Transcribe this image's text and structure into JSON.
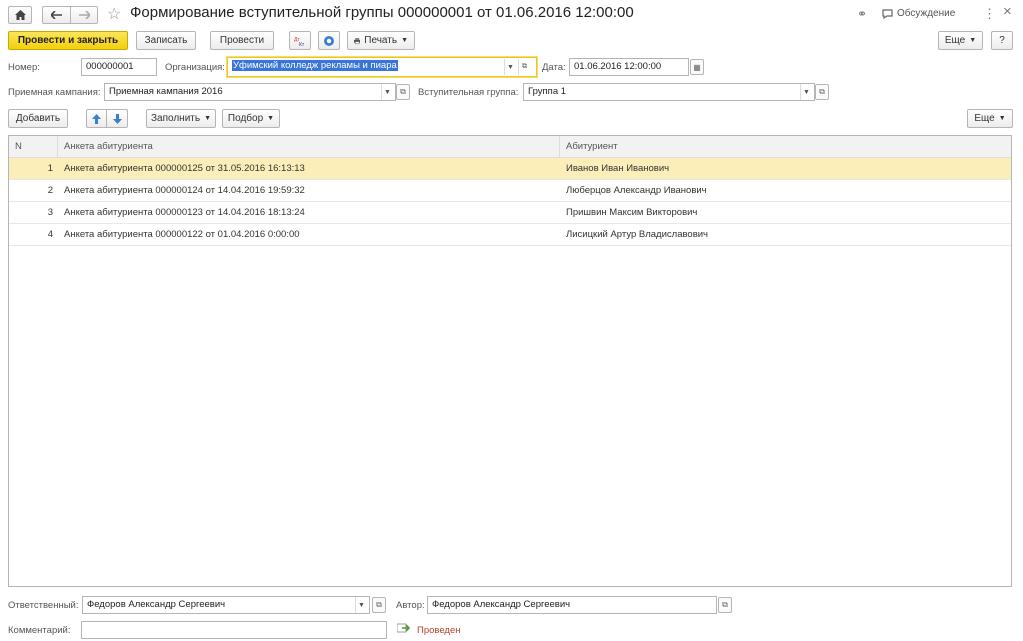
{
  "window": {
    "title": "Формирование вступительной группы 000000001 от 01.06.2016 12:00:00",
    "discussion_label": "Обсуждение",
    "more_icon": "⋮",
    "close_icon": "×"
  },
  "toolbar": {
    "post_close_label": "Провести и закрыть",
    "save_label": "Записать",
    "post_label": "Провести",
    "print_label": "Печать",
    "more_label": "Еще",
    "help_label": "?"
  },
  "form": {
    "number_label": "Номер:",
    "number_value": "000000001",
    "org_label": "Организация:",
    "org_value": "Уфимский колледж рекламы и пиара",
    "date_label": "Дата:",
    "date_value": "01.06.2016 12:00:00",
    "campaign_label": "Приемная кампания:",
    "campaign_value": "Приемная кампания 2016",
    "group_label": "Вступительная группа:",
    "group_value": "Группа 1"
  },
  "table_toolbar": {
    "add_label": "Добавить",
    "fill_label": "Заполнить",
    "pick_label": "Подбор",
    "more_label": "Еще"
  },
  "table": {
    "columns": [
      "N",
      "Анкета абитуриента",
      "Абитуриент"
    ],
    "rows": [
      {
        "n": "1",
        "form": "Анкета абитуриента 000000125 от 31.05.2016 16:13:13",
        "applicant": "Иванов Иван Иванович"
      },
      {
        "n": "2",
        "form": "Анкета абитуриента 000000124 от 14.04.2016 19:59:32",
        "applicant": "Люберцов Александр Иванович"
      },
      {
        "n": "3",
        "form": "Анкета абитуриента 000000123 от 14.04.2016 18:13:24",
        "applicant": "Пришвин Максим Викторович"
      },
      {
        "n": "4",
        "form": "Анкета абитуриента 000000122 от 01.04.2016 0:00:00",
        "applicant": "Лисицкий Артур Владиславович"
      }
    ]
  },
  "footer": {
    "responsible_label": "Ответственный:",
    "responsible_value": "Федоров Александр Сергеевич",
    "author_label": "Автор:",
    "author_value": "Федоров Александр Сергеевич",
    "comment_label": "Комментарий:",
    "comment_value": "",
    "status": "Проведен"
  },
  "colors": {
    "primary": "#f3cf0d",
    "selected_row": "#fbeeb9",
    "status": "#b3412a"
  }
}
